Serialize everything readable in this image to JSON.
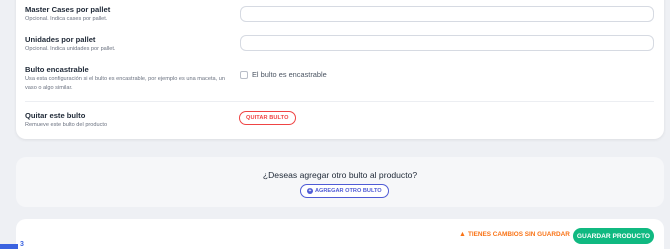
{
  "fields": {
    "master_cases": {
      "title": "Master Cases por pallet",
      "description": "Opcional. Indica cases por pallet.",
      "value": ""
    },
    "units": {
      "title": "Unidades por pallet",
      "description": "Opcional. Indica unidades por pallet.",
      "value": ""
    },
    "stackable": {
      "title": "Bulto encastrable",
      "description": "Usa esta configuración si el bulto es encastrable, por ejemplo es una maceta, un vaso o algo similar.",
      "checkbox_label": "El bulto es encastrable",
      "checked": false
    },
    "remove": {
      "title": "Quitar este bulto",
      "description": "Remueve este bulto del producto",
      "button_label": "QUITAR BULTO"
    }
  },
  "add_package": {
    "question": "¿Deseas agregar otro bulto al producto?",
    "button_label": "AGREGAR OTRO BULTO",
    "icon": "plus-circle-icon"
  },
  "footer": {
    "unsaved_label": "TIENES CAMBIOS SIN GUARDAR",
    "warning_icon": "warning-icon",
    "save_label": "GUARDAR PRODUCTO"
  },
  "step": {
    "number": "3"
  },
  "colors": {
    "danger": "#ef4444",
    "primary": "#4f5bd5",
    "success": "#10b981",
    "warning": "#f97316"
  }
}
